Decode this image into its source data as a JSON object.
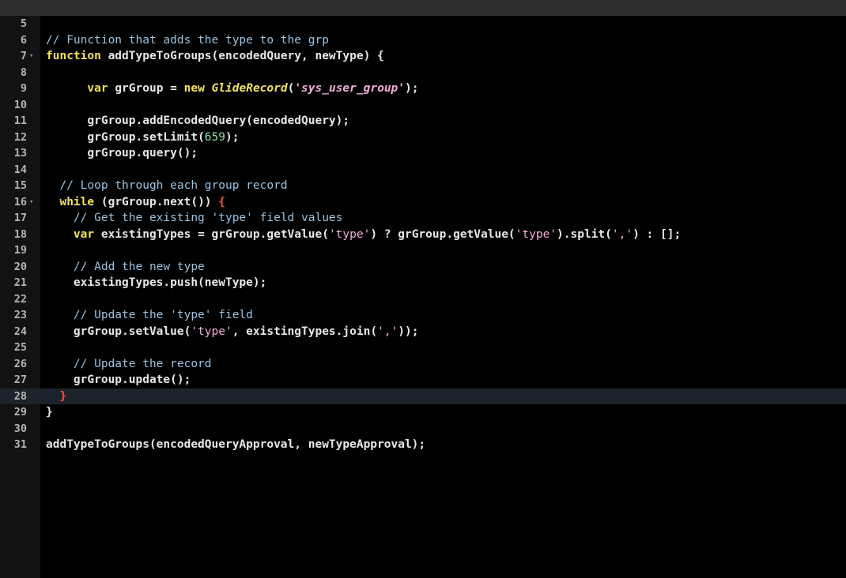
{
  "editor": {
    "theme": {
      "background": "#000000",
      "top_bar": "#2c2e30",
      "gutter": "#121212",
      "active_line": "#1d232c",
      "comment": "#9bc3e2",
      "keyword": "#f4e45a",
      "string": "#f2b0d8",
      "number": "#8ee0a3",
      "bracket_highlight": "#ff4b3b",
      "text": "#e8e8e8"
    },
    "active_line_number": "28",
    "fold_icon": "fold-arrow-down-icon",
    "lines": [
      {
        "n": "5",
        "indent": "",
        "tokens": []
      },
      {
        "n": "6",
        "indent": "",
        "tokens": [
          {
            "t": "comment",
            "v": "// Function that adds the type to the grp"
          }
        ]
      },
      {
        "n": "7",
        "fold": "▾",
        "indent": "",
        "tokens": [
          {
            "t": "keyword",
            "v": "function"
          },
          {
            "t": "plain",
            "v": " addTypeToGroups(encodedQuery, newType) {"
          }
        ]
      },
      {
        "n": "8",
        "indent": "",
        "tokens": []
      },
      {
        "n": "9",
        "indent": "      ",
        "tokens": [
          {
            "t": "keyword",
            "v": "var"
          },
          {
            "t": "plain",
            "v": " grGroup = "
          },
          {
            "t": "keyword",
            "v": "new"
          },
          {
            "t": "plain",
            "v": " "
          },
          {
            "t": "class",
            "v": "GlideRecord"
          },
          {
            "t": "plain",
            "v": "("
          },
          {
            "t": "string-italic",
            "v": "'sys_user_group'"
          },
          {
            "t": "plain",
            "v": ");"
          }
        ]
      },
      {
        "n": "10",
        "indent": "",
        "tokens": []
      },
      {
        "n": "11",
        "indent": "      ",
        "tokens": [
          {
            "t": "plain",
            "v": "grGroup.addEncodedQuery(encodedQuery);"
          }
        ]
      },
      {
        "n": "12",
        "indent": "      ",
        "tokens": [
          {
            "t": "plain",
            "v": "grGroup.setLimit("
          },
          {
            "t": "number",
            "v": "659"
          },
          {
            "t": "plain",
            "v": ");"
          }
        ]
      },
      {
        "n": "13",
        "indent": "      ",
        "tokens": [
          {
            "t": "plain",
            "v": "grGroup.query();"
          }
        ]
      },
      {
        "n": "14",
        "indent": "",
        "tokens": []
      },
      {
        "n": "15",
        "indent": "  ",
        "tokens": [
          {
            "t": "comment",
            "v": "// Loop through each group record"
          }
        ]
      },
      {
        "n": "16",
        "fold": "▾",
        "indent": "  ",
        "tokens": [
          {
            "t": "keyword",
            "v": "while"
          },
          {
            "t": "plain",
            "v": " (grGroup.next()) "
          },
          {
            "t": "brace-red",
            "v": "{"
          }
        ]
      },
      {
        "n": "17",
        "indent": "    ",
        "tokens": [
          {
            "t": "comment",
            "v": "// Get the existing 'type' field values"
          }
        ]
      },
      {
        "n": "18",
        "indent": "    ",
        "tokens": [
          {
            "t": "keyword",
            "v": "var"
          },
          {
            "t": "plain",
            "v": " existingTypes = grGroup.getValue("
          },
          {
            "t": "string",
            "v": "'type'"
          },
          {
            "t": "plain",
            "v": ") ? grGroup.getValue("
          },
          {
            "t": "string",
            "v": "'type'"
          },
          {
            "t": "plain",
            "v": ").split("
          },
          {
            "t": "string",
            "v": "','"
          },
          {
            "t": "plain",
            "v": ") : [];"
          }
        ]
      },
      {
        "n": "19",
        "indent": "",
        "tokens": []
      },
      {
        "n": "20",
        "indent": "    ",
        "tokens": [
          {
            "t": "comment",
            "v": "// Add the new type"
          }
        ]
      },
      {
        "n": "21",
        "indent": "    ",
        "tokens": [
          {
            "t": "plain",
            "v": "existingTypes.push(newType);"
          }
        ]
      },
      {
        "n": "22",
        "indent": "",
        "tokens": []
      },
      {
        "n": "23",
        "indent": "    ",
        "tokens": [
          {
            "t": "comment",
            "v": "// Update the 'type' field"
          }
        ]
      },
      {
        "n": "24",
        "indent": "    ",
        "tokens": [
          {
            "t": "plain",
            "v": "grGroup.setValue("
          },
          {
            "t": "string",
            "v": "'type'"
          },
          {
            "t": "plain",
            "v": ", existingTypes.join("
          },
          {
            "t": "string",
            "v": "','"
          },
          {
            "t": "plain",
            "v": "));"
          }
        ]
      },
      {
        "n": "25",
        "indent": "",
        "tokens": []
      },
      {
        "n": "26",
        "indent": "    ",
        "tokens": [
          {
            "t": "comment",
            "v": "// Update the record"
          }
        ]
      },
      {
        "n": "27",
        "indent": "    ",
        "tokens": [
          {
            "t": "plain",
            "v": "grGroup.update();"
          }
        ]
      },
      {
        "n": "28",
        "indent": "  ",
        "tokens": [
          {
            "t": "brace-red",
            "v": "}"
          }
        ]
      },
      {
        "n": "29",
        "indent": "",
        "tokens": [
          {
            "t": "plain",
            "v": "}"
          }
        ]
      },
      {
        "n": "30",
        "indent": "",
        "tokens": []
      },
      {
        "n": "31",
        "indent": "",
        "tokens": [
          {
            "t": "plain",
            "v": "addTypeToGroups(encodedQueryApproval, newTypeApproval);"
          }
        ]
      }
    ]
  }
}
